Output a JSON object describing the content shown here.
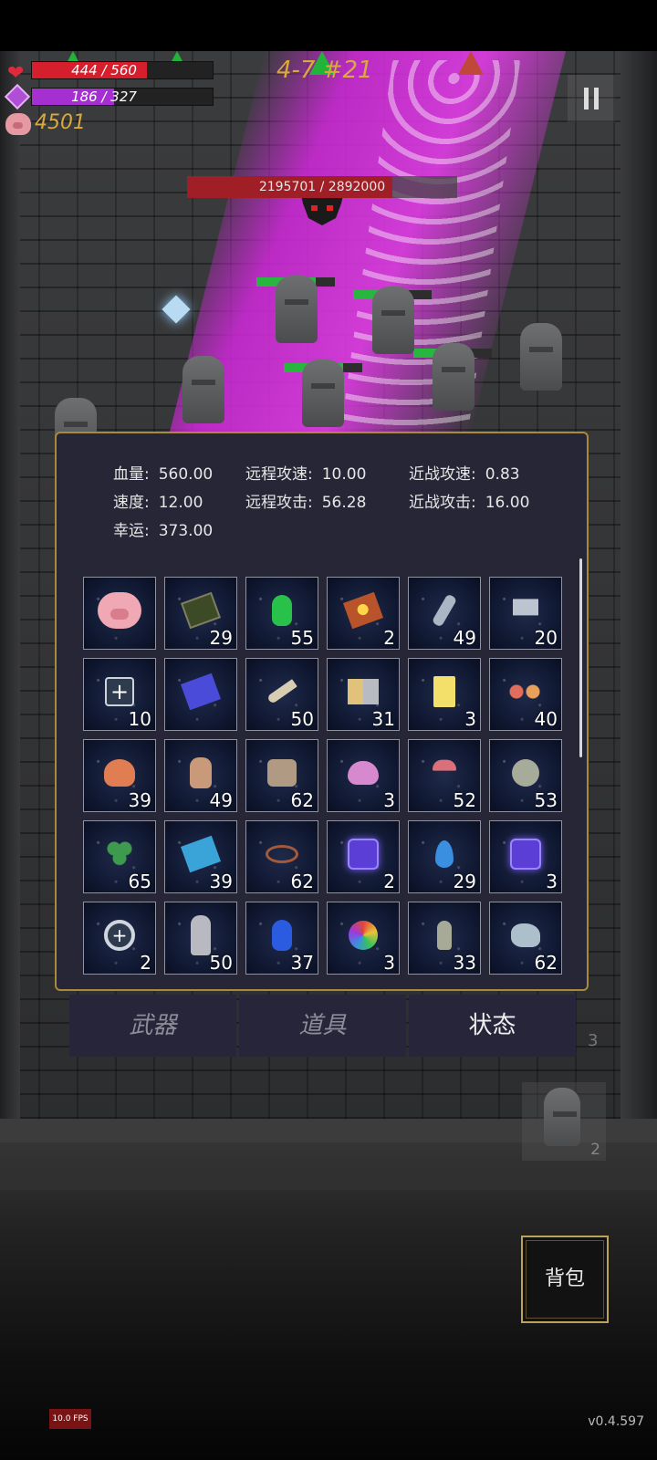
{
  "hud": {
    "hp_text": "444 / 560",
    "hp_value": 444,
    "hp_max": 560,
    "mp_text": "186 / 327",
    "mp_value": 186,
    "mp_max": 327,
    "coins": "4501",
    "stage": "4-7 #21",
    "boss_hp_text": "2195701 / 2892000",
    "boss_hp_value": 2195701,
    "boss_hp_max": 2892000
  },
  "stats": [
    {
      "label": "血量:",
      "value": "560.00"
    },
    {
      "label": "远程攻速:",
      "value": "10.00"
    },
    {
      "label": "近战攻速:",
      "value": "0.83"
    },
    {
      "label": "速度:",
      "value": "12.00"
    },
    {
      "label": "远程攻击:",
      "value": "56.28"
    },
    {
      "label": "近战攻击:",
      "value": "16.00"
    },
    {
      "label": "幸运:",
      "value": "373.00"
    }
  ],
  "inventory": [
    {
      "icon": "piggy-bank",
      "count": ""
    },
    {
      "icon": "skull-book",
      "count": "29"
    },
    {
      "icon": "green-potion",
      "count": "55"
    },
    {
      "icon": "red-spellbook",
      "count": "2"
    },
    {
      "icon": "crystal-vial",
      "count": "49"
    },
    {
      "icon": "war-hammer",
      "count": "20"
    },
    {
      "icon": "medkit",
      "count": "10"
    },
    {
      "icon": "blue-rune-book",
      "count": ""
    },
    {
      "icon": "horn",
      "count": "50"
    },
    {
      "icon": "metal-cubes",
      "count": "31"
    },
    {
      "icon": "hourglass-card",
      "count": "3"
    },
    {
      "icon": "flowers",
      "count": "40"
    },
    {
      "icon": "feathered-skull",
      "count": "39"
    },
    {
      "icon": "clay-vase",
      "count": "49"
    },
    {
      "icon": "boots",
      "count": "62"
    },
    {
      "icon": "pink-slime",
      "count": "3"
    },
    {
      "icon": "mushroom",
      "count": "52"
    },
    {
      "icon": "squid",
      "count": "53"
    },
    {
      "icon": "clover",
      "count": "65"
    },
    {
      "icon": "wind-book",
      "count": "39"
    },
    {
      "icon": "thorn-crown",
      "count": "62"
    },
    {
      "icon": "hourglass-rune",
      "count": "2"
    },
    {
      "icon": "water-drop",
      "count": "29"
    },
    {
      "icon": "spiral-rune",
      "count": "3"
    },
    {
      "icon": "health-ring",
      "count": "2"
    },
    {
      "icon": "cloaked-figure",
      "count": "50"
    },
    {
      "icon": "blue-potion",
      "count": "37"
    },
    {
      "icon": "rainbow-orb",
      "count": "3"
    },
    {
      "icon": "small-flask",
      "count": "33"
    },
    {
      "icon": "ice-rock",
      "count": "62"
    }
  ],
  "tabs": [
    {
      "label": "武器",
      "active": false
    },
    {
      "label": "道具",
      "active": false
    },
    {
      "label": "状态",
      "active": true
    }
  ],
  "side_card_count": "2",
  "behind_panel_count": "3",
  "bag_button": "背包",
  "fps": "10.0 FPS",
  "version": "v0.4.597",
  "colors": {
    "hp": "#d51f2c",
    "mp": "#a52fd0",
    "gold": "#d9a93e",
    "panel_border": "#a88a3c",
    "beam": "#d23cdc"
  }
}
